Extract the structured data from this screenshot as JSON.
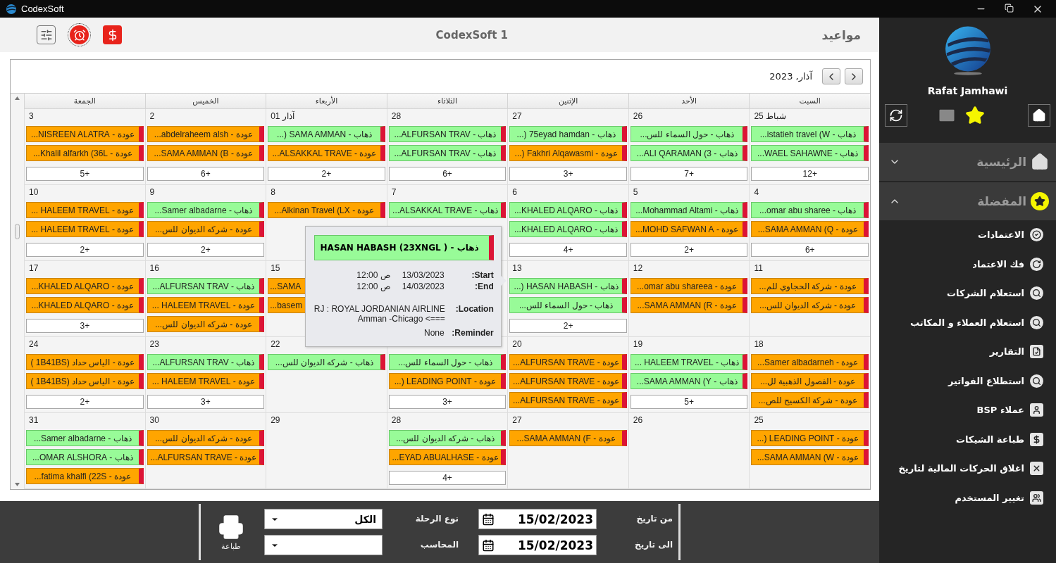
{
  "window": {
    "title": "CodexSoft"
  },
  "toolbar": {
    "title": "CodexSoft 1",
    "page_title": "مواعيد"
  },
  "calendar": {
    "month_label": "آذار, 2023",
    "weekdays": [
      "السبت",
      "الأحد",
      "الإثنين",
      "الثلاثاء",
      "الأربعاء",
      "الخميس",
      "الجمعة"
    ],
    "weeks": [
      [
        {
          "day": "25 شباط",
          "appointments": [
            {
              "kind": "departure",
              "text": "ذهاب - istatieh travel  (W..."
            },
            {
              "kind": "departure",
              "text": "ذهاب - WAEL SAHAWNE..."
            }
          ],
          "more": "12+"
        },
        {
          "day": "26",
          "appointments": [
            {
              "kind": "departure",
              "text": "ذهاب - حول السماء للس..."
            },
            {
              "kind": "departure",
              "text": "ذهاب - ALI QARAMAN (3..."
            }
          ],
          "more": "7+"
        },
        {
          "day": "27",
          "appointments": [
            {
              "kind": "departure",
              "text": "ذهاب - 75eyad hamdan (..."
            },
            {
              "kind": "return",
              "text": "عودة - Fakhri Alqawasmi (..."
            }
          ],
          "more": "3+"
        },
        {
          "day": "28",
          "appointments": [
            {
              "kind": "departure",
              "text": "ذهاب - ALFURSAN TRAV..."
            },
            {
              "kind": "departure",
              "text": "ذهاب - ALFURSAN TRAV..."
            }
          ],
          "more": "6+"
        },
        {
          "day": "01 آذار",
          "appointments": [
            {
              "kind": "departure",
              "text": "ذهاب - SAMA AMMAN  (..."
            },
            {
              "kind": "return",
              "text": "عودة - ALSAKKAL TRAVE..."
            }
          ],
          "more": "2+"
        },
        {
          "day": "2",
          "appointments": [
            {
              "kind": "return",
              "text": "عودة - abdelraheem alsh..."
            },
            {
              "kind": "return",
              "text": "عودة - SAMA AMMAN  (B..."
            }
          ],
          "more": "6+"
        },
        {
          "day": "3",
          "appointments": [
            {
              "kind": "return",
              "text": "عودة - NISREEN ALATRA..."
            },
            {
              "kind": "return",
              "text": "عودة - Khalil alfarkh (36L..."
            }
          ],
          "more": "5+"
        }
      ],
      [
        {
          "day": "4",
          "appointments": [
            {
              "kind": "departure",
              "text": "ذهاب - omar abu sharee..."
            },
            {
              "kind": "return",
              "text": "عودة - SAMA AMMAN  (Q..."
            }
          ],
          "more": "6+"
        },
        {
          "day": "5",
          "appointments": [
            {
              "kind": "departure",
              "text": "ذهاب - Mohammad Altami..."
            },
            {
              "kind": "return",
              "text": "عودة - MOHD SAFWAN A..."
            }
          ],
          "more": "2+"
        },
        {
          "day": "6",
          "appointments": [
            {
              "kind": "departure",
              "text": "ذهاب - KHALED ALQARO..."
            },
            {
              "kind": "departure",
              "text": "ذهاب - KHALED ALQARO..."
            }
          ],
          "more": "4+"
        },
        {
          "day": "7",
          "appointments": [
            {
              "kind": "departure",
              "text": "ذهاب - ALSAKKAL TRAVE..."
            }
          ]
        },
        {
          "day": "8",
          "appointments": [
            {
              "kind": "return",
              "text": "عودة - Alkinan Travel  (LX..."
            }
          ]
        },
        {
          "day": "9",
          "appointments": [
            {
              "kind": "departure",
              "text": "ذهاب - Samer albadarne..."
            },
            {
              "kind": "return",
              "text": "عودة - شركه الديوان للس..."
            }
          ],
          "more": "2+"
        },
        {
          "day": "10",
          "appointments": [
            {
              "kind": "return",
              "text": "عودة - HALEEM TRAVEL  ..."
            },
            {
              "kind": "return",
              "text": "عودة - HALEEM TRAVEL  ..."
            }
          ],
          "more": "2+"
        }
      ],
      [
        {
          "day": "11",
          "appointments": [
            {
              "kind": "return",
              "text": "عودة - شركة الحجاوي للم..."
            },
            {
              "kind": "return",
              "text": "عودة - شركه الديوان للس..."
            }
          ]
        },
        {
          "day": "12",
          "appointments": [
            {
              "kind": "return",
              "text": "عودة - omar abu shareea..."
            },
            {
              "kind": "return",
              "text": "عودة - SAMA AMMAN  (R..."
            }
          ]
        },
        {
          "day": "13",
          "appointments": [
            {
              "kind": "departure",
              "text": "ذهاب - HASAN HABASH (..."
            },
            {
              "kind": "departure",
              "text": "ذهاب - حول السماء للس..."
            }
          ],
          "more": "2+"
        },
        {
          "popup": {
            "title": "ذهاب - HASAN HABASH (23XNGL )",
            "kind": "departure",
            "fields": [
              {
                "kind": "inline",
                "label": "Start:",
                "values": [
                  "13/03/2023",
                  "12:00 ص"
                ]
              },
              {
                "kind": "inline",
                "label": "End:",
                "values": [
                  "14/03/2023",
                  "12:00 ص"
                ]
              },
              {
                "kind": "stacked",
                "label": "Location:",
                "values": [
                  "RJ : ROYAL JORDANIAN AIRLINE",
                  "Amman -Chicago <==="
                ]
              },
              {
                "kind": "inline",
                "label": "Reminder:",
                "values": [
                  "None"
                ]
              }
            ]
          }
        },
        {
          "day": "15",
          "appointments": [
            {
              "kind": "return",
              "text": "...SAMA",
              "cut": true
            },
            {
              "kind": "return",
              "text": "...basem",
              "cut": true
            }
          ]
        },
        {
          "day": "16",
          "appointments": [
            {
              "kind": "departure",
              "text": "ذهاب - ALFURSAN TRAV..."
            },
            {
              "kind": "return",
              "text": "عودة - HALEEM TRAVEL  ..."
            },
            {
              "kind": "return",
              "text": "عودة - شركه الديوان للس..."
            }
          ]
        },
        {
          "day": "17",
          "appointments": [
            {
              "kind": "return",
              "text": "عودة - KHALED ALQARO..."
            },
            {
              "kind": "return",
              "text": "عودة - KHALED ALQARO..."
            }
          ],
          "more": "3+"
        }
      ],
      [
        {
          "day": "18",
          "appointments": [
            {
              "kind": "return",
              "text": "عودة - Samer albadarneh..."
            },
            {
              "kind": "return",
              "text": "عودة - الفصول الذهبية لل..."
            },
            {
              "kind": "return",
              "text": "عودة - شركة الكسيح للص..."
            }
          ]
        },
        {
          "day": "19",
          "appointments": [
            {
              "kind": "departure",
              "text": "ذهاب - HALEEM TRAVEL  ..."
            },
            {
              "kind": "departure",
              "text": "ذهاب - SAMA AMMAN  (Y..."
            }
          ],
          "more": "5+"
        },
        {
          "day": "20",
          "appointments": [
            {
              "kind": "return",
              "text": "عودة - ALFURSAN TRAVE..."
            },
            {
              "kind": "return",
              "text": "عودة - ALFURSAN TRAVE..."
            },
            {
              "kind": "return",
              "text": "عودة - ALFURSAN TRAVE..."
            }
          ]
        },
        {
          "appointments": [
            {
              "kind": "departure",
              "text": "ذهاب - حول السماء للس..."
            },
            {
              "kind": "return",
              "text": "عودة - LEADING POINT  (..."
            }
          ],
          "more": "3+"
        },
        {
          "day": "22",
          "appointments": [
            {
              "kind": "departure",
              "text": "ذهاب - شركه الديوان للس..."
            }
          ]
        },
        {
          "day": "23",
          "appointments": [
            {
              "kind": "departure",
              "text": "ذهاب - ALFURSAN TRAV..."
            },
            {
              "kind": "return",
              "text": "عودة - HALEEM TRAVEL  ..."
            }
          ],
          "more": "3+"
        },
        {
          "day": "24",
          "appointments": [
            {
              "kind": "return",
              "text": "عودة - الياس حداد (1B41BS )"
            },
            {
              "kind": "return",
              "text": "عودة - الياس حداد (1B41BS )"
            }
          ],
          "more": "2+"
        }
      ],
      [
        {
          "day": "25",
          "appointments": [
            {
              "kind": "return",
              "text": "عودة - LEADING POINT  (..."
            },
            {
              "kind": "return",
              "text": "عودة - SAMA AMMAN  (W..."
            }
          ]
        },
        {
          "day": "26"
        },
        {
          "day": "27",
          "appointments": [
            {
              "kind": "return",
              "text": "عودة - SAMA AMMAN  (F..."
            }
          ]
        },
        {
          "day": "28",
          "appointments": [
            {
              "kind": "departure",
              "text": "ذهاب - شركه الديوان للس..."
            },
            {
              "kind": "return",
              "text": "عودة - EYAD ABUALHASE..."
            }
          ],
          "more": "4+"
        },
        {
          "day": "29"
        },
        {
          "day": "30",
          "appointments": [
            {
              "kind": "return",
              "text": "عودة - شركه الديوان للس..."
            },
            {
              "kind": "return",
              "text": "عودة - ALFURSAN TRAVE..."
            }
          ]
        },
        {
          "day": "31",
          "appointments": [
            {
              "kind": "departure",
              "text": "ذهاب - Samer albadarne..."
            },
            {
              "kind": "departure",
              "text": "ذهاب - OMAR ALSHORA..."
            },
            {
              "kind": "return",
              "text": "عودة - fatima khalfi (22S..."
            }
          ]
        }
      ]
    ]
  },
  "filters": {
    "print_label": "طباعة",
    "from_date": {
      "label": "من تاريخ",
      "value": "15/02/2023"
    },
    "to_date": {
      "label": "الى تاريخ",
      "value": "15/02/2023"
    },
    "trip_type": {
      "label": "نوع الرحلة",
      "value": "الكل"
    },
    "accountant": {
      "label": "المحاسب"
    }
  },
  "sidebar": {
    "user": "Rafat Jamhawi",
    "groups": [
      {
        "label": "الرئيسية",
        "kind": "home",
        "expanded": false
      },
      {
        "label": "المفضلة",
        "kind": "star",
        "expanded": true,
        "items": [
          {
            "kind": "approve",
            "label": "الاعتمادات"
          },
          {
            "kind": "undo",
            "label": "فك الاعتماد"
          },
          {
            "kind": "search",
            "label": "استعلام الشركات"
          },
          {
            "kind": "search",
            "label": "استعلام العملاء و المكاتب"
          },
          {
            "kind": "report",
            "label": "التقارير"
          },
          {
            "kind": "search",
            "label": "استطلاع الفواتير"
          },
          {
            "kind": "user",
            "label": "عملاء BSP"
          },
          {
            "kind": "cheque",
            "label": "طباعة الشيكات"
          },
          {
            "kind": "close",
            "label": "اغلاق الحركات المالية لتاريخ"
          },
          {
            "kind": "users",
            "label": "تغيير المستخدم"
          }
        ]
      }
    ]
  }
}
